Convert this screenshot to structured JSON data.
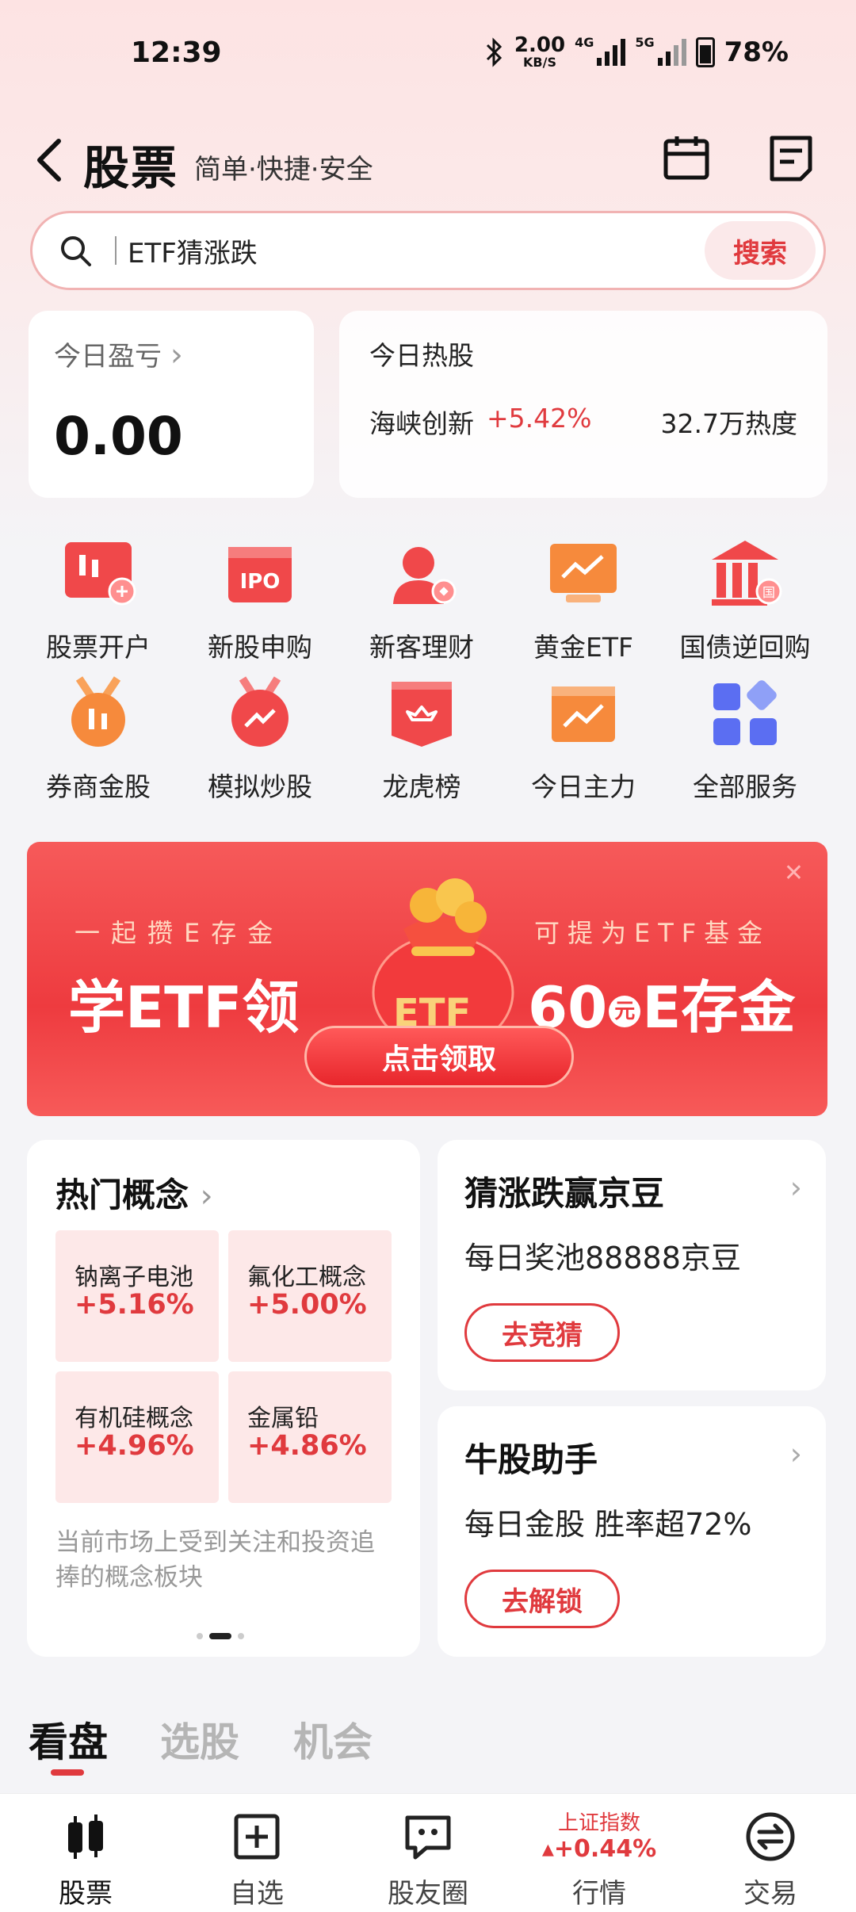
{
  "status_bar": {
    "time": "12:39",
    "net_speed_value": "2.00",
    "net_speed_unit": "KB/S",
    "net_type": "4G",
    "net_type2": "5G",
    "battery": "78%"
  },
  "header": {
    "title": "股票",
    "subtitle": "简单·快捷·安全"
  },
  "search": {
    "placeholder": "ETF猜涨跌",
    "button": "搜索"
  },
  "pnl": {
    "label": "今日盈亏",
    "value": "0.00"
  },
  "hot_stock": {
    "label": "今日热股",
    "name": "海峡创新",
    "change": "+5.42%",
    "heat": "32.7万热度"
  },
  "services": [
    {
      "label": "股票开户",
      "icon": "stock-account-icon"
    },
    {
      "label": "新股申购",
      "icon": "ipo-icon"
    },
    {
      "label": "新客理财",
      "icon": "new-customer-icon"
    },
    {
      "label": "黄金ETF",
      "icon": "gold-etf-icon"
    },
    {
      "label": "国债逆回购",
      "icon": "bank-icon"
    },
    {
      "label": "券商金股",
      "icon": "medal-icon"
    },
    {
      "label": "模拟炒股",
      "icon": "simulate-icon"
    },
    {
      "label": "龙虎榜",
      "icon": "crown-icon"
    },
    {
      "label": "今日主力",
      "icon": "calendar-chart-icon"
    },
    {
      "label": "全部服务",
      "icon": "grid-icon"
    }
  ],
  "banner": {
    "left_small": "一起攒E存金",
    "left_big": "学ETF领",
    "right_small": "可提为ETF基金",
    "right_big_num": "60",
    "right_big_unit": "元",
    "right_big_text": "E存金",
    "bag_text": "ETF",
    "cta": "点击领取"
  },
  "concepts": {
    "title": "热门概念",
    "tiles": [
      {
        "name": "钠离子电池",
        "change": "+5.16%"
      },
      {
        "name": "氟化工概念",
        "change": "+5.00%"
      },
      {
        "name": "有机硅概念",
        "change": "+4.96%"
      },
      {
        "name": "金属铅",
        "change": "+4.86%"
      }
    ],
    "description": "当前市场上受到关注和投资追捧的概念板块"
  },
  "promos": [
    {
      "title": "猜涨跌赢京豆",
      "subtitle": "每日奖池88888京豆",
      "button": "去竞猜"
    },
    {
      "title": "牛股助手",
      "subtitle": "每日金股 胜率超72%",
      "button": "去解锁"
    }
  ],
  "tabs": [
    "看盘",
    "选股",
    "机会"
  ],
  "bottom_nav": {
    "items": [
      "股票",
      "自选",
      "股友圈",
      "行情",
      "交易"
    ],
    "index_name": "上证指数",
    "index_change": "+0.44%"
  },
  "colors": {
    "accent_red": "#e03a3e",
    "tile_bg": "#fde8e8"
  }
}
